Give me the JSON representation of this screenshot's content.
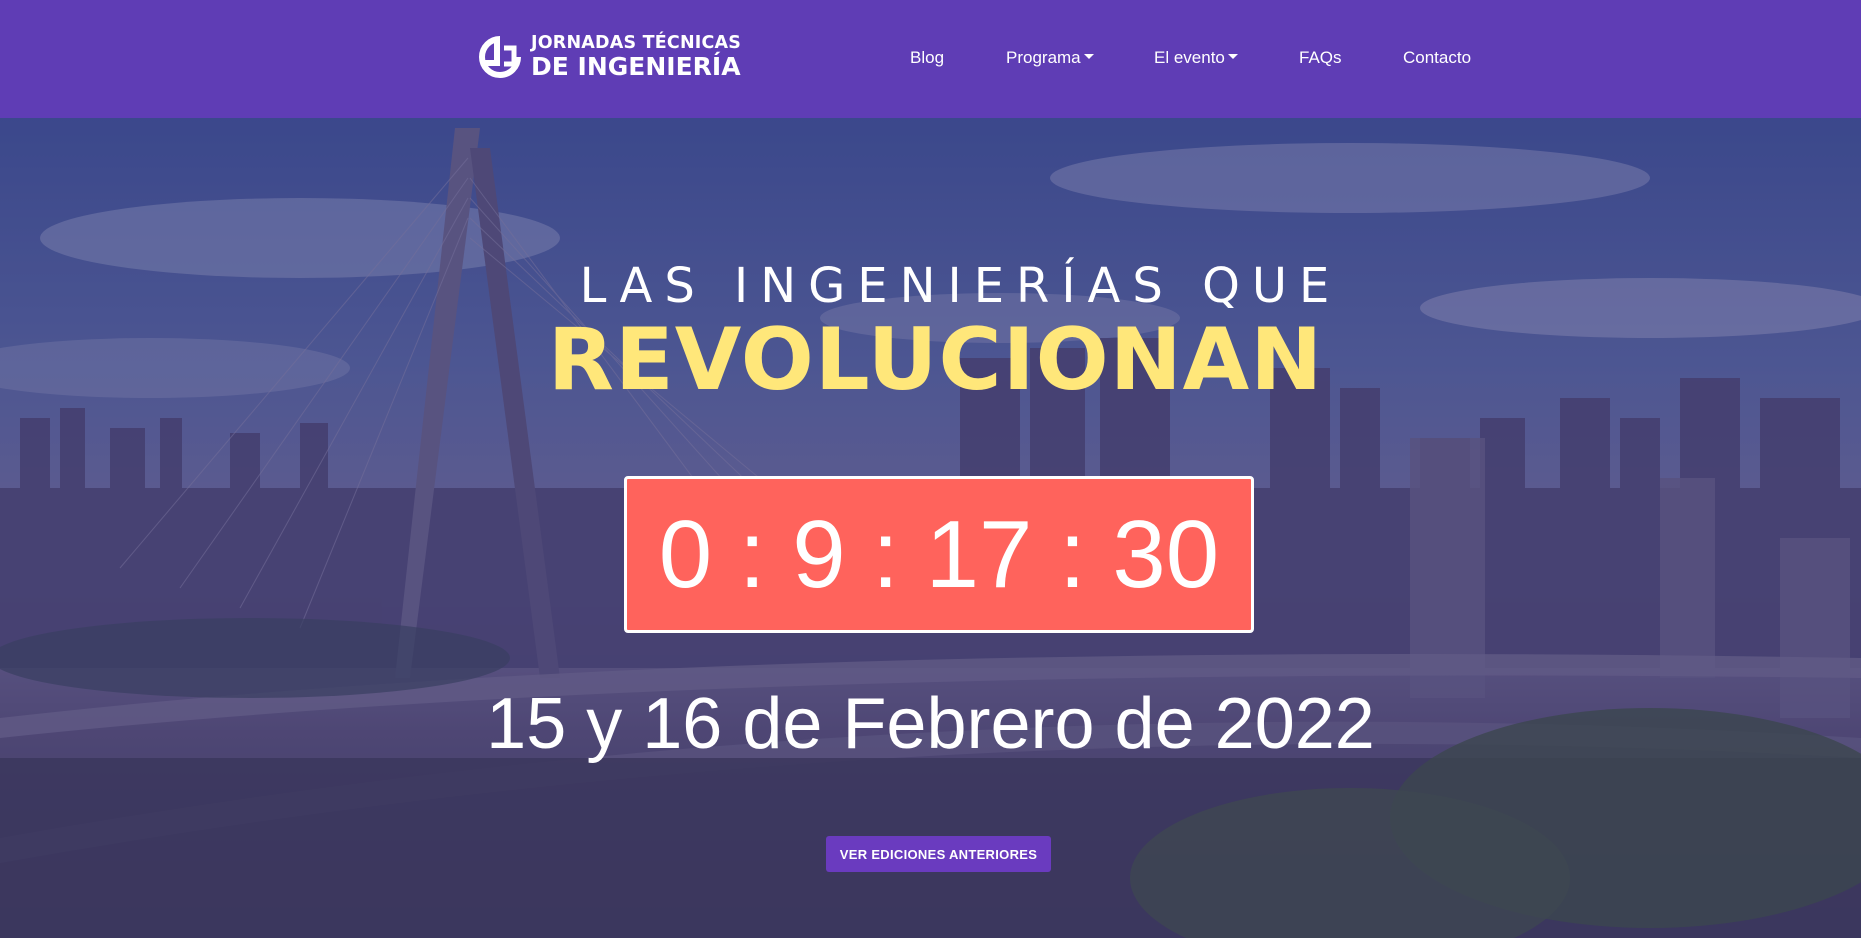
{
  "brand": {
    "line1": "JORNADAS TÉCNICAS",
    "line2": "DE INGENIERÍA",
    "logo_icon": "jti-logo-icon"
  },
  "nav": {
    "blog": "Blog",
    "programa": "Programa",
    "evento": "El evento",
    "faqs": "FAQs",
    "contacto": "Contacto"
  },
  "hero": {
    "headline_top": "LAS INGENIERÍAS QUE",
    "headline_main": "REVOLUCIONAN",
    "countdown": {
      "text": "0 : 9 : 17 : 30",
      "days": 0,
      "hours": 9,
      "minutes": 17,
      "seconds": 30
    },
    "date": "15 y 16 de Febrero de 2022",
    "cta_label": "VER EDICIONES ANTERIORES"
  },
  "colors": {
    "navbar": "#5f3db5",
    "headline_accent": "#ffe77a",
    "countdown_bg": "#ff635c",
    "cta_bg": "#6a3bbf"
  }
}
